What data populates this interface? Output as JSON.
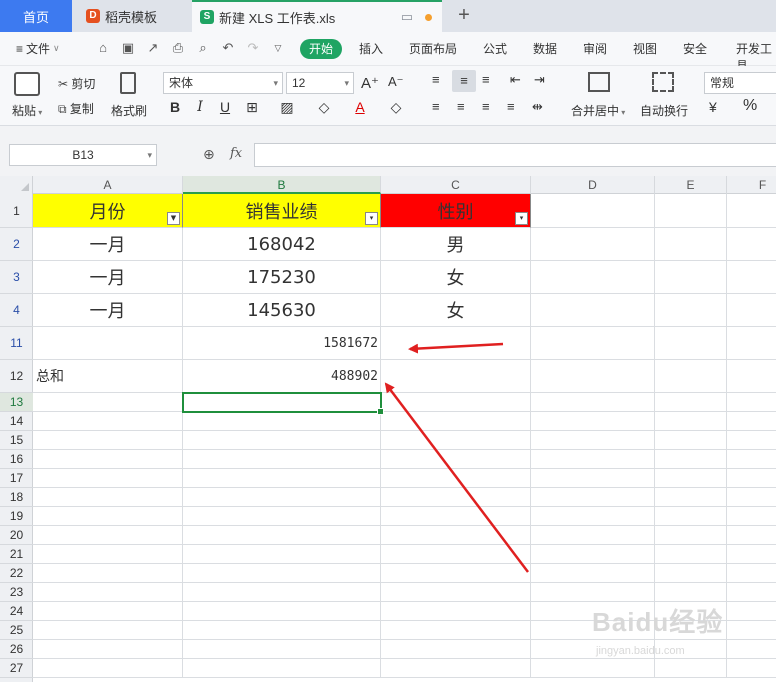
{
  "tabs": {
    "home": "首页",
    "template": "稻壳模板",
    "template_icon": "D",
    "file": "新建 XLS 工作表.xls",
    "file_icon": "S",
    "new_tab": "+"
  },
  "menu": {
    "file": "文件",
    "items": [
      "开始",
      "插入",
      "页面布局",
      "公式",
      "数据",
      "审阅",
      "视图",
      "安全",
      "开发工具"
    ]
  },
  "toolbar": {
    "paste": "粘贴",
    "cut": "剪切",
    "copy": "复制",
    "format_painter": "格式刷",
    "font_name": "宋体",
    "font_size": "12",
    "merge_center": "合并居中",
    "wrap_text": "自动换行",
    "number_format": "常规",
    "percent": "%"
  },
  "formula_bar": {
    "name_box": "B13",
    "fx": "fx",
    "formula": ""
  },
  "columns": [
    "A",
    "B",
    "C",
    "D",
    "E",
    "F"
  ],
  "rows": [
    "1",
    "2",
    "3",
    "4",
    "11",
    "12",
    "13",
    "14",
    "15",
    "16",
    "17",
    "18",
    "19",
    "20",
    "21",
    "22",
    "23",
    "24",
    "25",
    "26",
    "27"
  ],
  "cells": {
    "A1": "月份",
    "B1": "销售业绩",
    "C1": "性别",
    "A2": "一月",
    "B2": "168042",
    "C2": "男",
    "A3": "一月",
    "B3": "175230",
    "C3": "女",
    "A4": "一月",
    "B4": "145630",
    "C4": "女",
    "B11": "1581672",
    "A12": "总和",
    "B12": "488902"
  },
  "colors": {
    "header_yellow": "#ffff00",
    "header_red": "#ff0000",
    "accent_green": "#1fa463",
    "annotation_arrow": "#e02020"
  },
  "watermark": {
    "main": "Baidu经验",
    "sub": "jingyan.baidu.com"
  }
}
